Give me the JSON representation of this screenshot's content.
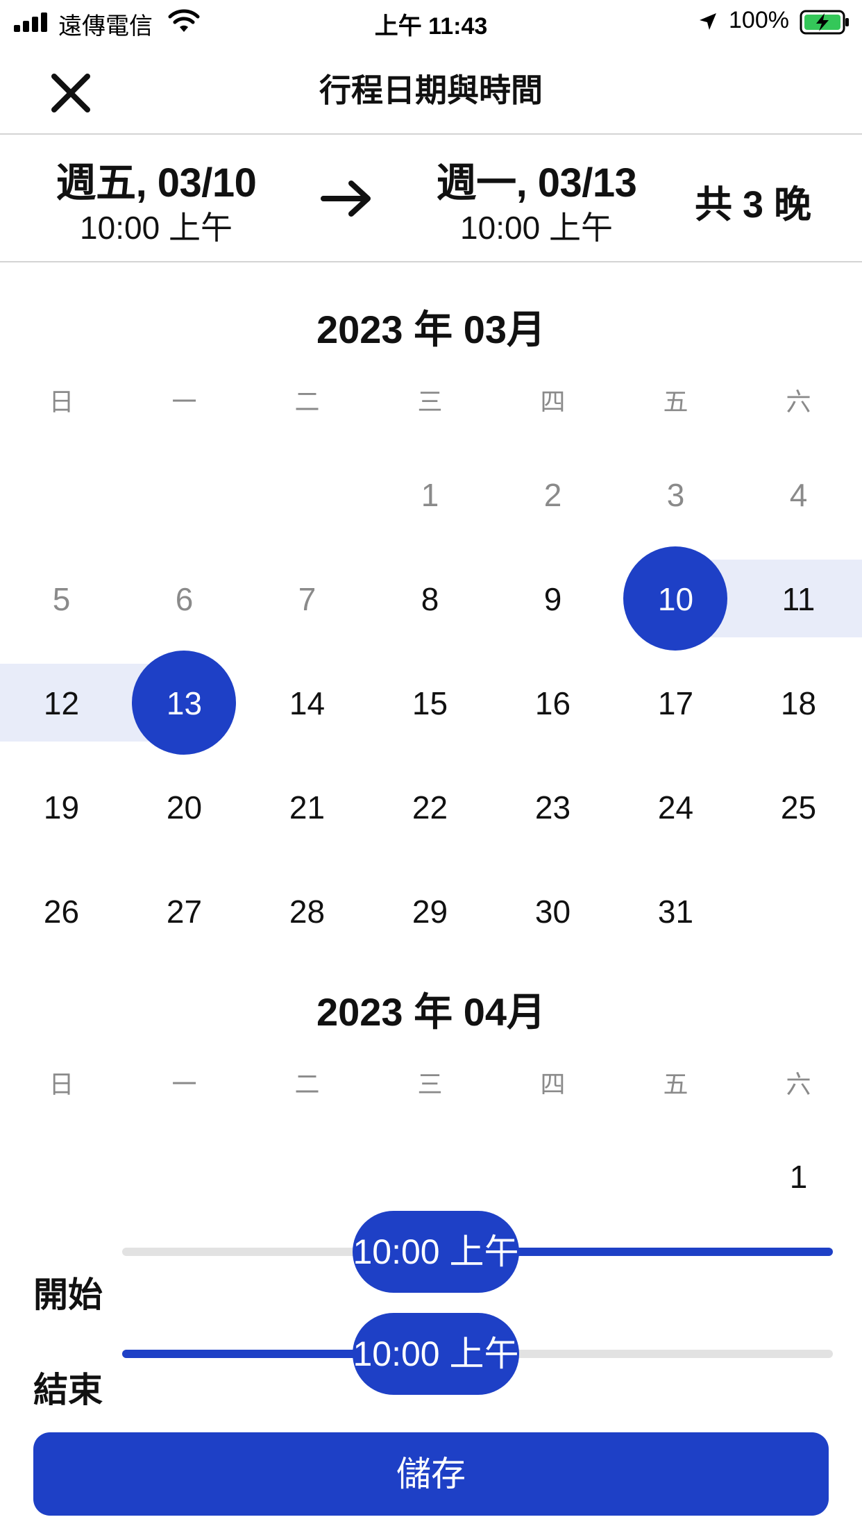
{
  "status_bar": {
    "carrier": "遠傳電信",
    "time": "上午 11:43",
    "battery": "100%"
  },
  "header": {
    "title": "行程日期與時間",
    "close_icon": "close-icon"
  },
  "summary": {
    "start_date": "週五, 03/10",
    "start_time": "10:00 上午",
    "end_date": "週一, 03/13",
    "end_time": "10:00 上午",
    "nights": "共 3 晚"
  },
  "weekdays": [
    "日",
    "一",
    "二",
    "三",
    "四",
    "五",
    "六"
  ],
  "months": [
    {
      "title": "2023 年 03月",
      "days": [
        "1",
        "2",
        "3",
        "4",
        "5",
        "6",
        "7",
        "8",
        "9",
        "10",
        "11",
        "12",
        "13",
        "14",
        "15",
        "16",
        "17",
        "18",
        "19",
        "20",
        "21",
        "22",
        "23",
        "24",
        "25",
        "26",
        "27",
        "28",
        "29",
        "30",
        "31"
      ]
    },
    {
      "title": "2023 年 04月",
      "days": [
        "1"
      ]
    }
  ],
  "sliders": {
    "start_label": "開始",
    "start_value": "10:00 上午",
    "end_label": "結束",
    "end_value": "10:00 上午"
  },
  "save_label": "儲存",
  "colors": {
    "accent": "#1e40c6",
    "range": "#e8ecf9"
  }
}
